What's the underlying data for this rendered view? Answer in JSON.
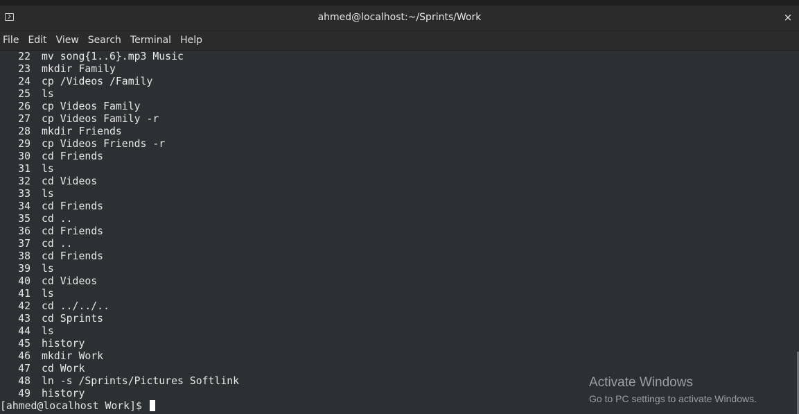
{
  "window": {
    "title": "ahmed@localhost:~/Sprints/Work",
    "icon": "terminal-icon",
    "close_label": "×"
  },
  "menu": [
    "File",
    "Edit",
    "View",
    "Search",
    "Terminal",
    "Help"
  ],
  "history": [
    {
      "num": "22",
      "cmd": "mv song{1..6}.mp3 Music"
    },
    {
      "num": "23",
      "cmd": "mkdir Family"
    },
    {
      "num": "24",
      "cmd": "cp /Videos /Family"
    },
    {
      "num": "25",
      "cmd": "ls"
    },
    {
      "num": "26",
      "cmd": "cp Videos Family"
    },
    {
      "num": "27",
      "cmd": "cp Videos Family -r"
    },
    {
      "num": "28",
      "cmd": "mkdir Friends"
    },
    {
      "num": "29",
      "cmd": "cp Videos Friends -r"
    },
    {
      "num": "30",
      "cmd": "cd Friends"
    },
    {
      "num": "31",
      "cmd": "ls"
    },
    {
      "num": "32",
      "cmd": "cd Videos"
    },
    {
      "num": "33",
      "cmd": "ls"
    },
    {
      "num": "34",
      "cmd": "cd Friends"
    },
    {
      "num": "35",
      "cmd": "cd .."
    },
    {
      "num": "36",
      "cmd": "cd Friends"
    },
    {
      "num": "37",
      "cmd": "cd .."
    },
    {
      "num": "38",
      "cmd": "cd Friends"
    },
    {
      "num": "39",
      "cmd": "ls"
    },
    {
      "num": "40",
      "cmd": "cd Videos"
    },
    {
      "num": "41",
      "cmd": "ls"
    },
    {
      "num": "42",
      "cmd": "cd ../../.."
    },
    {
      "num": "43",
      "cmd": "cd Sprints"
    },
    {
      "num": "44",
      "cmd": "ls"
    },
    {
      "num": "45",
      "cmd": "history"
    },
    {
      "num": "46",
      "cmd": "mkdir Work"
    },
    {
      "num": "47",
      "cmd": "cd Work"
    },
    {
      "num": "48",
      "cmd": "ln -s /Sprints/Pictures Softlink"
    },
    {
      "num": "49",
      "cmd": "history"
    }
  ],
  "prompt": "[ahmed@localhost Work]$ ",
  "watermark": {
    "title": "Activate Windows",
    "subtitle": "Go to PC settings to activate Windows."
  },
  "colors": {
    "terminal_bg": "#2b3033",
    "titlebar_bg": "#2b2b2b",
    "text": "#e8e8e8"
  }
}
